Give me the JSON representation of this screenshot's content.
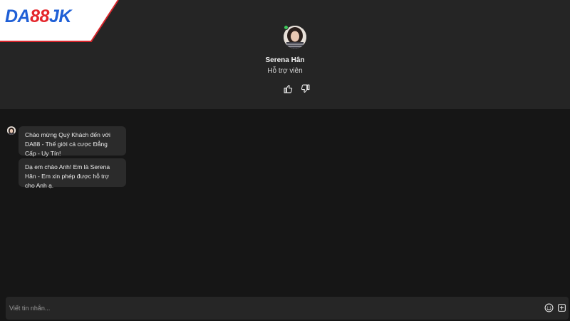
{
  "brand": {
    "logo_part1": "DA",
    "logo_part2": "88",
    "logo_part3": "JK",
    "colors": {
      "blue": "#1f5fd6",
      "red": "#e4252b",
      "white": "#ffffff"
    }
  },
  "agent": {
    "name": "Serena Hân",
    "role": "Hỗ trợ viên",
    "status": "online",
    "status_color": "#3ec85b",
    "icons": {
      "avatar": "agent-avatar",
      "like": "thumbs-up-icon",
      "dislike": "thumbs-down-icon"
    }
  },
  "messages": [
    {
      "sender": "agent",
      "text": "Chào mừng Quý Khách đến với DA88 - Thế giới cá cược Đẳng Cấp - Uy Tín!"
    },
    {
      "sender": "agent",
      "text": "Dạ em chào Anh! Em là Serena Hân - Em xin phép được hỗ trợ cho Anh ạ."
    }
  ],
  "composer": {
    "placeholder": "Viết tin nhắn...",
    "value": "",
    "icons": {
      "emoji": "emoji-icon",
      "attach": "attach-icon"
    }
  },
  "theme": {
    "header_bg": "#252525",
    "chat_bg": "#161616",
    "bubble_bg": "#2b2b2b",
    "composer_bg": "#262626"
  }
}
